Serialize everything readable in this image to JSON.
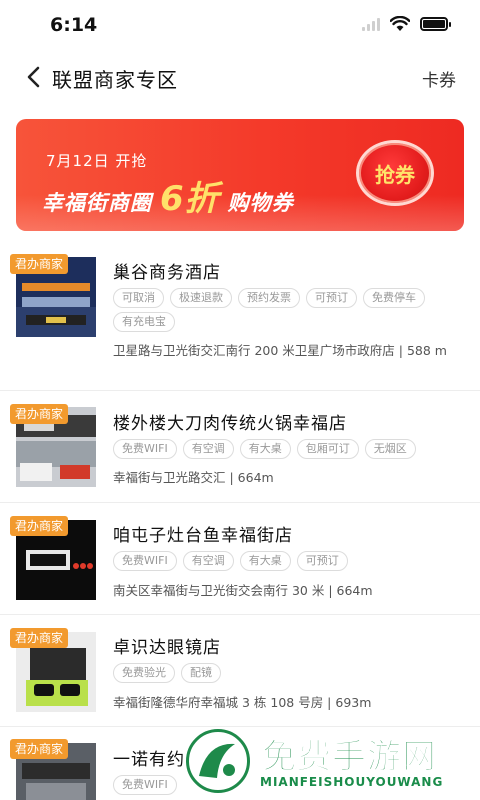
{
  "status_bar": {
    "time": "6:14"
  },
  "header": {
    "title": "联盟商家专区",
    "right_link": "卡券"
  },
  "banner": {
    "date_text": "7月12日 开抢",
    "shop_text": "幸福街商圈",
    "discount_text": "6折",
    "coupon_text": "购物券",
    "button_label": "抢券"
  },
  "shops": [
    {
      "badge": "君办商家",
      "name": "巢谷商务酒店",
      "tags": [
        "可取消",
        "极速退款",
        "预约发票",
        "可预订",
        "免费停车",
        "有充电宝"
      ],
      "address": "卫星路与卫光街交汇南行 200 米卫星广场市政府店 | 588 m"
    },
    {
      "badge": "君办商家",
      "name": "楼外楼大刀肉传统火锅幸福店",
      "tags": [
        "免费WIFI",
        "有空调",
        "有大桌",
        "包厢可订",
        "无烟区"
      ],
      "address": "幸福街与卫光路交汇 | 664m"
    },
    {
      "badge": "君办商家",
      "name": "咱屯子灶台鱼幸福街店",
      "tags": [
        "免费WIFI",
        "有空调",
        "有大桌",
        "可预订"
      ],
      "address": "南关区幸福街与卫光街交会南行 30 米 | 664m"
    },
    {
      "badge": "君办商家",
      "name": "卓识达眼镜店",
      "tags": [
        "免费验光",
        "配镜"
      ],
      "address": "幸福街隆德华府幸福城 3 栋 108 号房 | 693m"
    },
    {
      "badge": "君办商家",
      "name": "一诺有约",
      "tags": [
        "免费WIFI"
      ],
      "address": ""
    }
  ],
  "watermark": {
    "title": "免费手游网",
    "subtitle": "MIANFEISHOUYOUWANG"
  },
  "colors": {
    "accent": "#f43a2a",
    "badge": "#f29a2e",
    "watermark": "#1a8c4a"
  }
}
